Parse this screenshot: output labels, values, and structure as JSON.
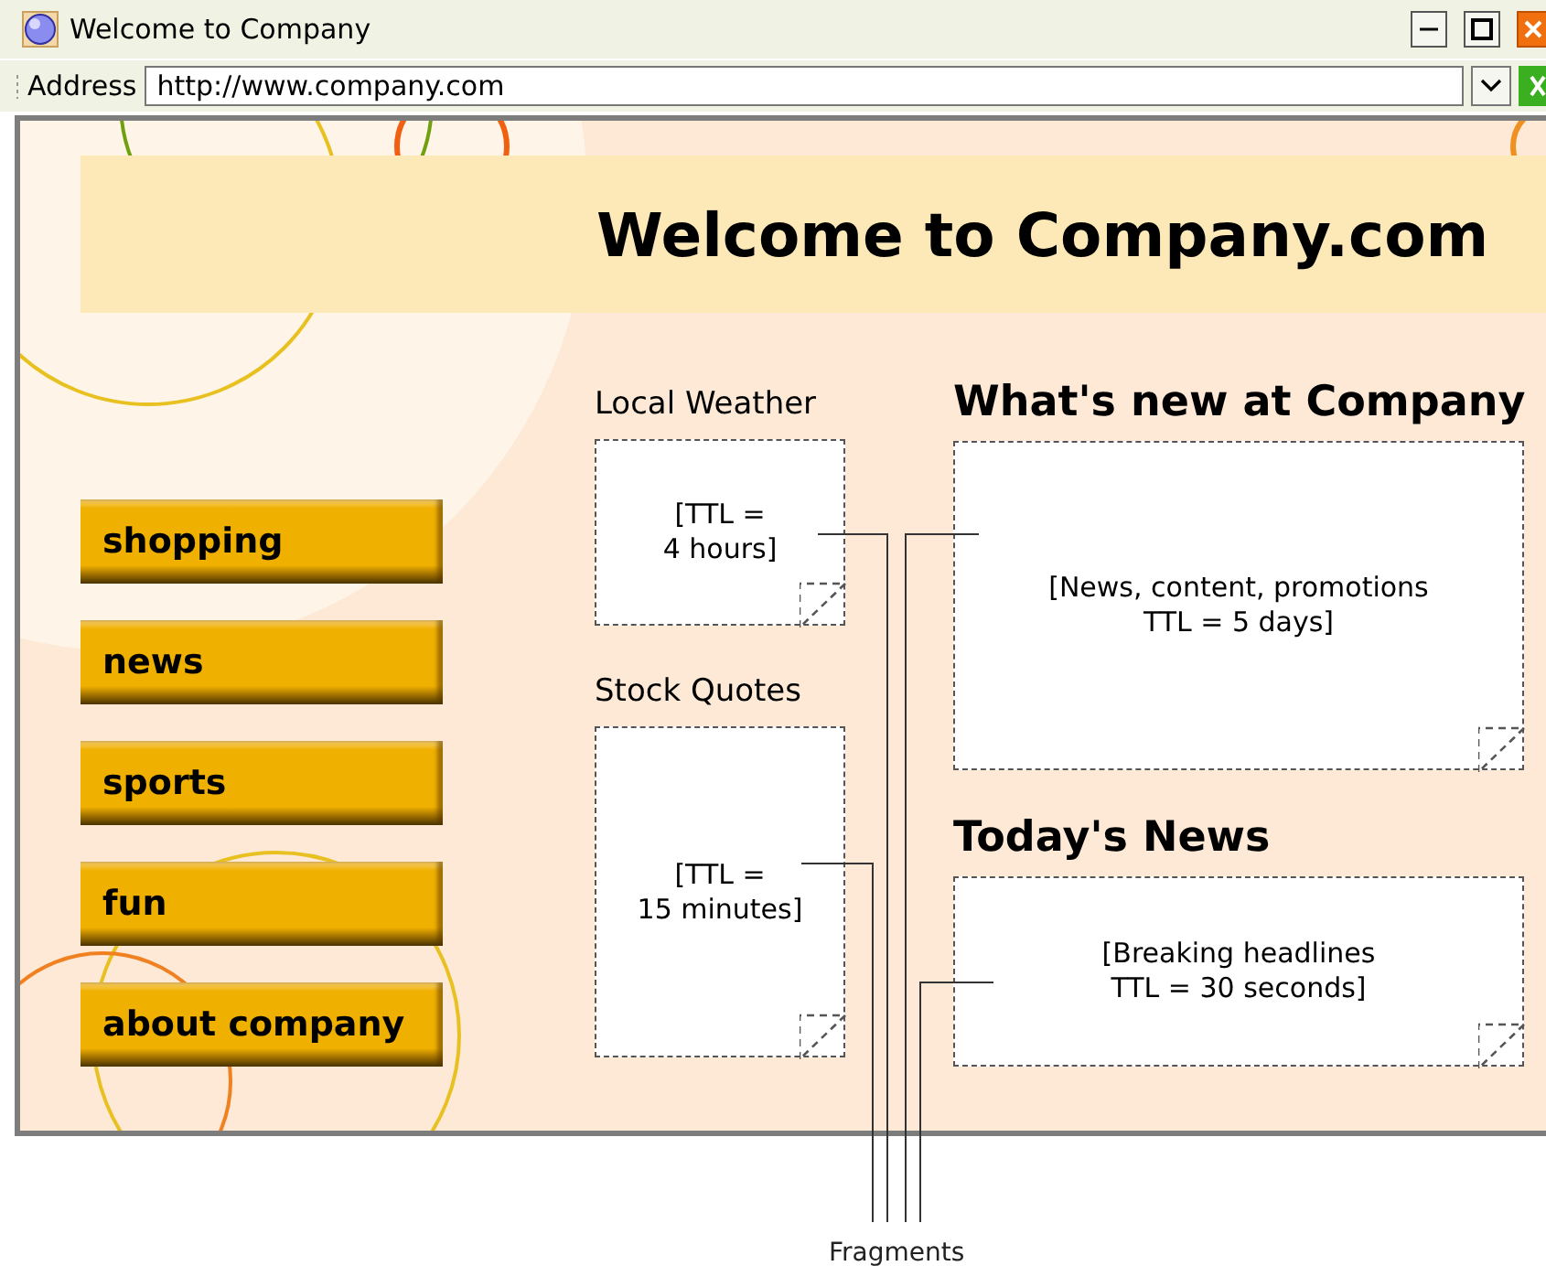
{
  "window": {
    "title": "Welcome to Company"
  },
  "address_bar": {
    "label": "Address",
    "value": "http://www.company.com"
  },
  "page": {
    "heading": "Welcome to Company.com",
    "nav": [
      {
        "label": "shopping"
      },
      {
        "label": "news"
      },
      {
        "label": "sports"
      },
      {
        "label": "fun"
      },
      {
        "label": "about company"
      }
    ],
    "left_column": [
      {
        "title": "Local Weather",
        "text": "[TTL =\n4 hours]"
      },
      {
        "title": "Stock Quotes",
        "text": "[TTL =\n15 minutes]"
      }
    ],
    "right_column": [
      {
        "title": "What's new at Company",
        "text": "[News, content, promotions\nTTL = 5 days]"
      },
      {
        "title": "Today's News",
        "text": "[Breaking headlines\nTTL = 30 seconds]"
      }
    ]
  },
  "annotation": {
    "label": "Fragments"
  }
}
